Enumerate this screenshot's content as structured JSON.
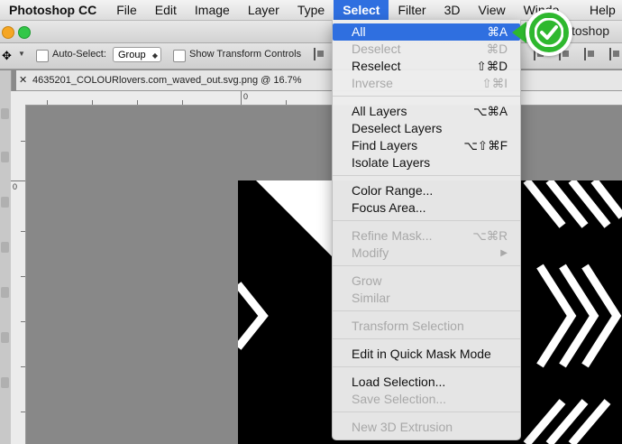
{
  "menubar": {
    "app_name": "Photoshop CC",
    "items": [
      "File",
      "Edit",
      "Image",
      "Layer",
      "Type",
      "Select",
      "Filter",
      "3D",
      "View",
      "Windo",
      "Help"
    ],
    "active": "Select"
  },
  "window": {
    "title_fragment": "toshop"
  },
  "options_bar": {
    "auto_select_label": "Auto-Select:",
    "auto_select_value": "Group",
    "show_transform_label": "Show Transform Controls"
  },
  "document": {
    "tab_title": "4635201_COLOURlovers.com_waved_out.svg.png @ 16.7%"
  },
  "rulers": {
    "top_zero": "0",
    "left_zero": "0"
  },
  "select_menu": {
    "items": [
      {
        "label": "All",
        "shortcut": "⌘A",
        "disabled": false,
        "highlighted": true
      },
      {
        "label": "Deselect",
        "shortcut": "⌘D",
        "disabled": true
      },
      {
        "label": "Reselect",
        "shortcut": "⇧⌘D",
        "disabled": false
      },
      {
        "label": "Inverse",
        "shortcut": "⇧⌘I",
        "disabled": true
      },
      {
        "label": "All Layers",
        "shortcut": "⌥⌘A",
        "disabled": false
      },
      {
        "label": "Deselect Layers",
        "shortcut": "",
        "disabled": false
      },
      {
        "label": "Find Layers",
        "shortcut": "⌥⇧⌘F",
        "disabled": false
      },
      {
        "label": "Isolate Layers",
        "shortcut": "",
        "disabled": false
      },
      {
        "label": "Color Range...",
        "shortcut": "",
        "disabled": false
      },
      {
        "label": "Focus Area...",
        "shortcut": "",
        "disabled": false
      },
      {
        "label": "Refine Mask...",
        "shortcut": "⌥⌘R",
        "disabled": true
      },
      {
        "label": "Modify",
        "shortcut": "▶",
        "disabled": true
      },
      {
        "label": "Grow",
        "shortcut": "",
        "disabled": true
      },
      {
        "label": "Similar",
        "shortcut": "",
        "disabled": true
      },
      {
        "label": "Transform Selection",
        "shortcut": "",
        "disabled": true
      },
      {
        "label": "Edit in Quick Mask Mode",
        "shortcut": "",
        "disabled": false
      },
      {
        "label": "Load Selection...",
        "shortcut": "",
        "disabled": false
      },
      {
        "label": "Save Selection...",
        "shortcut": "",
        "disabled": true
      },
      {
        "label": "New 3D Extrusion",
        "shortcut": "",
        "disabled": true
      }
    ]
  },
  "colors": {
    "menu_highlight": "#2f6fe0",
    "badge_green": "#2eb82e",
    "artwork_black": "#000000",
    "artwork_white": "#ffffff"
  },
  "icons": {
    "badge": "checkmark-icon",
    "move_tool": "move-icon"
  }
}
